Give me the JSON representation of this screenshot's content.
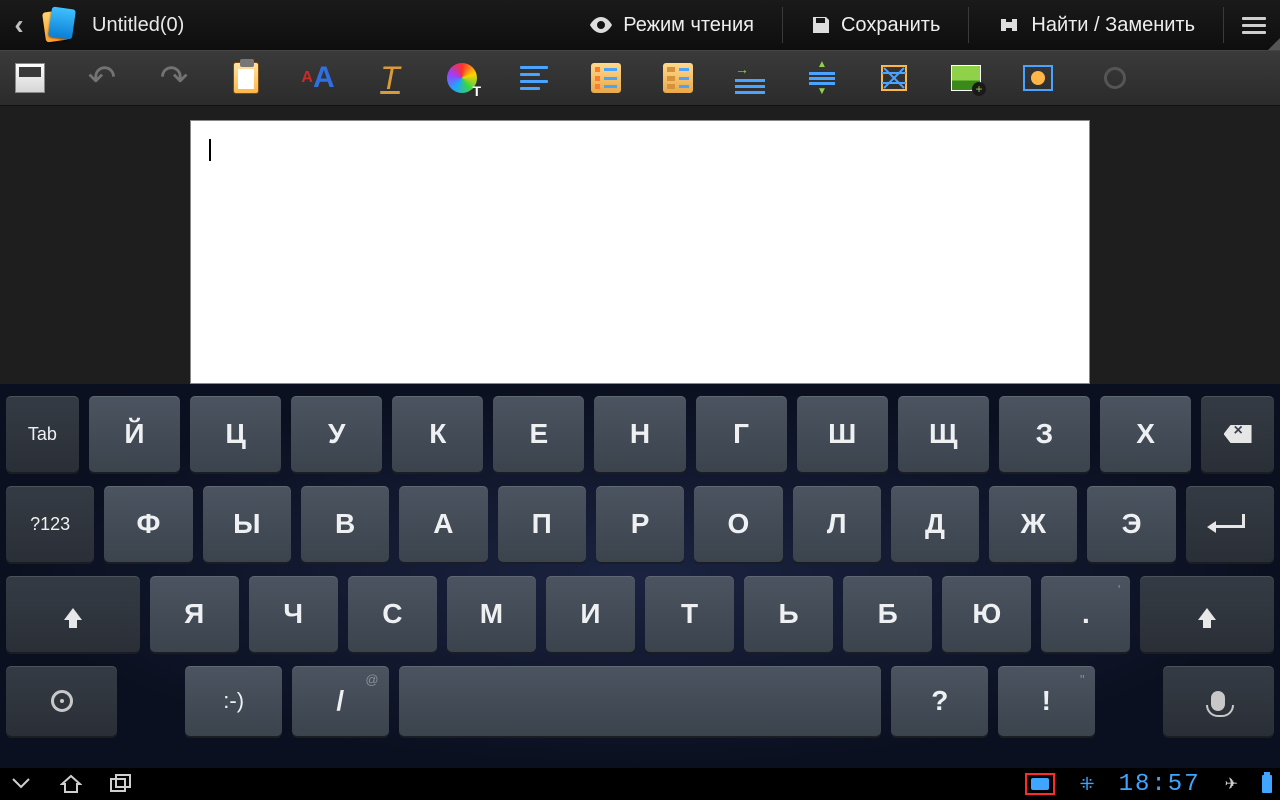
{
  "titlebar": {
    "document_title": "Untitled(0)",
    "reading_mode": "Режим чтения",
    "save": "Сохранить",
    "find_replace": "Найти / Заменить"
  },
  "toolbar_icons": {
    "save": "save-icon",
    "undo": "undo-icon",
    "redo": "redo-icon",
    "clipboard": "clipboard-icon",
    "font": "font-size-icon",
    "italic": "text-style-icon",
    "color": "font-color-icon",
    "align": "paragraph-align-icon",
    "bullets": "bullet-list-icon",
    "numbers": "number-list-icon",
    "indent": "indent-icon",
    "spacing": "line-spacing-icon",
    "columns": "columns-icon",
    "image": "insert-image-icon",
    "shape": "insert-shape-icon"
  },
  "keyboard": {
    "tab": "Tab",
    "sym": "?123",
    "row1": [
      "Й",
      "Ц",
      "У",
      "К",
      "Е",
      "Н",
      "Г",
      "Ш",
      "Щ",
      "З",
      "Х"
    ],
    "row2": [
      "Ф",
      "Ы",
      "В",
      "А",
      "П",
      "Р",
      "О",
      "Л",
      "Д",
      "Ж",
      "Э"
    ],
    "row3": [
      "Я",
      "Ч",
      "С",
      "М",
      "И",
      "Т",
      "Ь",
      "Б",
      "Ю",
      "."
    ],
    "row4": {
      "smiley": ":-)",
      "slash": "/",
      "slash_alt": "@",
      "qmark": "?",
      "excl": "!",
      "excl_alt": "\"",
      "dot_alt": "'"
    }
  },
  "statusbar": {
    "time": "18:57"
  }
}
